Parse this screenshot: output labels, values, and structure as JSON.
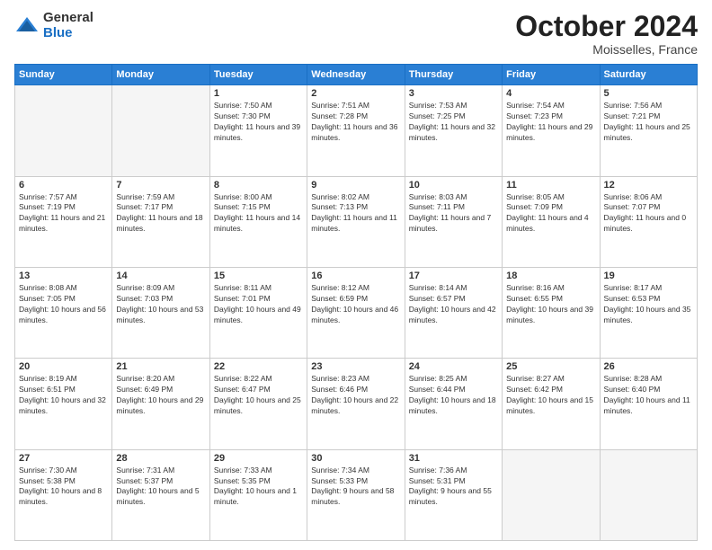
{
  "logo": {
    "general": "General",
    "blue": "Blue"
  },
  "header": {
    "month": "October 2024",
    "location": "Moisselles, France"
  },
  "weekdays": [
    "Sunday",
    "Monday",
    "Tuesday",
    "Wednesday",
    "Thursday",
    "Friday",
    "Saturday"
  ],
  "weeks": [
    [
      {
        "day": "",
        "info": ""
      },
      {
        "day": "",
        "info": ""
      },
      {
        "day": "1",
        "info": "Sunrise: 7:50 AM\nSunset: 7:30 PM\nDaylight: 11 hours and 39 minutes."
      },
      {
        "day": "2",
        "info": "Sunrise: 7:51 AM\nSunset: 7:28 PM\nDaylight: 11 hours and 36 minutes."
      },
      {
        "day": "3",
        "info": "Sunrise: 7:53 AM\nSunset: 7:25 PM\nDaylight: 11 hours and 32 minutes."
      },
      {
        "day": "4",
        "info": "Sunrise: 7:54 AM\nSunset: 7:23 PM\nDaylight: 11 hours and 29 minutes."
      },
      {
        "day": "5",
        "info": "Sunrise: 7:56 AM\nSunset: 7:21 PM\nDaylight: 11 hours and 25 minutes."
      }
    ],
    [
      {
        "day": "6",
        "info": "Sunrise: 7:57 AM\nSunset: 7:19 PM\nDaylight: 11 hours and 21 minutes."
      },
      {
        "day": "7",
        "info": "Sunrise: 7:59 AM\nSunset: 7:17 PM\nDaylight: 11 hours and 18 minutes."
      },
      {
        "day": "8",
        "info": "Sunrise: 8:00 AM\nSunset: 7:15 PM\nDaylight: 11 hours and 14 minutes."
      },
      {
        "day": "9",
        "info": "Sunrise: 8:02 AM\nSunset: 7:13 PM\nDaylight: 11 hours and 11 minutes."
      },
      {
        "day": "10",
        "info": "Sunrise: 8:03 AM\nSunset: 7:11 PM\nDaylight: 11 hours and 7 minutes."
      },
      {
        "day": "11",
        "info": "Sunrise: 8:05 AM\nSunset: 7:09 PM\nDaylight: 11 hours and 4 minutes."
      },
      {
        "day": "12",
        "info": "Sunrise: 8:06 AM\nSunset: 7:07 PM\nDaylight: 11 hours and 0 minutes."
      }
    ],
    [
      {
        "day": "13",
        "info": "Sunrise: 8:08 AM\nSunset: 7:05 PM\nDaylight: 10 hours and 56 minutes."
      },
      {
        "day": "14",
        "info": "Sunrise: 8:09 AM\nSunset: 7:03 PM\nDaylight: 10 hours and 53 minutes."
      },
      {
        "day": "15",
        "info": "Sunrise: 8:11 AM\nSunset: 7:01 PM\nDaylight: 10 hours and 49 minutes."
      },
      {
        "day": "16",
        "info": "Sunrise: 8:12 AM\nSunset: 6:59 PM\nDaylight: 10 hours and 46 minutes."
      },
      {
        "day": "17",
        "info": "Sunrise: 8:14 AM\nSunset: 6:57 PM\nDaylight: 10 hours and 42 minutes."
      },
      {
        "day": "18",
        "info": "Sunrise: 8:16 AM\nSunset: 6:55 PM\nDaylight: 10 hours and 39 minutes."
      },
      {
        "day": "19",
        "info": "Sunrise: 8:17 AM\nSunset: 6:53 PM\nDaylight: 10 hours and 35 minutes."
      }
    ],
    [
      {
        "day": "20",
        "info": "Sunrise: 8:19 AM\nSunset: 6:51 PM\nDaylight: 10 hours and 32 minutes."
      },
      {
        "day": "21",
        "info": "Sunrise: 8:20 AM\nSunset: 6:49 PM\nDaylight: 10 hours and 29 minutes."
      },
      {
        "day": "22",
        "info": "Sunrise: 8:22 AM\nSunset: 6:47 PM\nDaylight: 10 hours and 25 minutes."
      },
      {
        "day": "23",
        "info": "Sunrise: 8:23 AM\nSunset: 6:46 PM\nDaylight: 10 hours and 22 minutes."
      },
      {
        "day": "24",
        "info": "Sunrise: 8:25 AM\nSunset: 6:44 PM\nDaylight: 10 hours and 18 minutes."
      },
      {
        "day": "25",
        "info": "Sunrise: 8:27 AM\nSunset: 6:42 PM\nDaylight: 10 hours and 15 minutes."
      },
      {
        "day": "26",
        "info": "Sunrise: 8:28 AM\nSunset: 6:40 PM\nDaylight: 10 hours and 11 minutes."
      }
    ],
    [
      {
        "day": "27",
        "info": "Sunrise: 7:30 AM\nSunset: 5:38 PM\nDaylight: 10 hours and 8 minutes."
      },
      {
        "day": "28",
        "info": "Sunrise: 7:31 AM\nSunset: 5:37 PM\nDaylight: 10 hours and 5 minutes."
      },
      {
        "day": "29",
        "info": "Sunrise: 7:33 AM\nSunset: 5:35 PM\nDaylight: 10 hours and 1 minute."
      },
      {
        "day": "30",
        "info": "Sunrise: 7:34 AM\nSunset: 5:33 PM\nDaylight: 9 hours and 58 minutes."
      },
      {
        "day": "31",
        "info": "Sunrise: 7:36 AM\nSunset: 5:31 PM\nDaylight: 9 hours and 55 minutes."
      },
      {
        "day": "",
        "info": ""
      },
      {
        "day": "",
        "info": ""
      }
    ]
  ]
}
